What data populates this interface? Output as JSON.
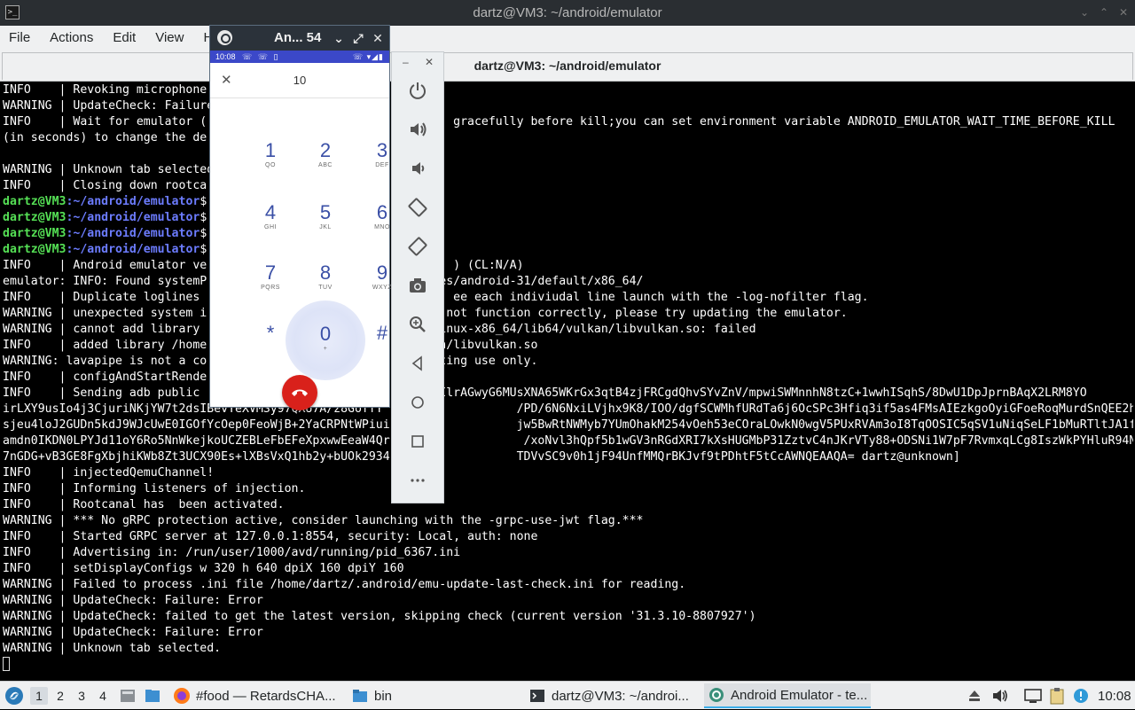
{
  "terminal": {
    "window_title": "dartz@VM3: ~/android/emulator",
    "menu": [
      "File",
      "Actions",
      "Edit",
      "View",
      "Help"
    ],
    "tab_title": "dartz@VM3: ~/android/emulator",
    "lines": [
      {
        "t": "INFO    | Revoking microphone"
      },
      {
        "t": "WARNING | UpdateCheck: Failure"
      },
      {
        "t": "INFO    | Wait for emulator (                                   gracefully before kill;you can set environment variable ANDROID_EMULATOR_WAIT_TIME_BEFORE_KILL"
      },
      {
        "t": "(in seconds) to change the de"
      },
      {
        "t": ""
      },
      {
        "t": "WARNING | Unknown tab selected"
      },
      {
        "t": "INFO    | Closing down rootca"
      },
      {
        "prompt": true,
        "user": "dartz@VM3",
        "path": ":~/android/emulator",
        "rest": "$"
      },
      {
        "prompt": true,
        "user": "dartz@VM3",
        "path": ":~/android/emulator",
        "rest": "$"
      },
      {
        "prompt": true,
        "user": "dartz@VM3",
        "path": ":~/android/emulator",
        "rest": "$"
      },
      {
        "prompt": true,
        "user": "dartz@VM3",
        "path": ":~/android/emulator",
        "rest": "$"
      },
      {
        "t": "INFO    | Android emulator ve                                   ) (CL:N/A)"
      },
      {
        "t": "emulator: INFO: Found systemP                               ages/android-31/default/x86_64/"
      },
      {
        "t": "INFO    | Duplicate loglines                                    ee each indiviudal line launch with the -log-nofilter flag."
      },
      {
        "t": "WARNING | unexpected system i                               nt not function correctly, please try updating the emulator."
      },
      {
        "t": "WARNING | cannot add library                                /linux-x86_64/lib64/vulkan/libvulkan.so: failed"
      },
      {
        "t": "INFO    | added library /home                               kan/libvulkan.so"
      },
      {
        "t": "WARNING: lavapipe is not a co                               esting use only."
      },
      {
        "t": "INFO    | configAndStartRende"
      },
      {
        "t": "INFO    | Sending adb public                                xUIlrAGwyG6MUsXNA65WKrGx3qtB4zjFRCgdQhvSYvZnV/mpwiSWMnnhN8tzC+1wwhISqhS/8DwU1DpJprnBAqX2LRM8YO"
      },
      {
        "t": "irLXY9usIo4j3CjuriNKjYW7t2dsIBevYeXVMSy97QXU7A/z8GoffY                   /PD/6N6NxiLVjhx9K8/IOO/dgfSCWMhfURdTa6j6OcSPc3Hfiq3if5as4FMsAIEzkgoOyiGFoeRoqMurdSnQEE2hfyY8al"
      },
      {
        "t": "sjeu4loJ2GUDn5kdJ9WJcUwE0IGOfYcOep0FeoWjB+2YaCRPNtWPiui                  jw5BwRtNWMyb7YUmOhakM254vOeh53eCOraLOwkN0wgV5PUxRVAm3oI8TqOOSIC5qSV1uNiqSeLF1bMuRTltJA1fKOkLvS"
      },
      {
        "t": "amdn0IKDN0LPYJd11oY6Ro5NnWkejkoUCZEBLeFbEFeXpxwwEeaW4Qr                   /xoNvl3hQpf5b1wGV3nRGdXRI7kXsHUGMbP31ZztvC4nJKrVTy88+ODSNi1W7pF7RvmxqLCg8IszWkPYHluR94Ngj8iRsK"
      },
      {
        "t": "7nGDG+vB3GE8FgXbjhiKWb8Zt3UCX90Es+lXBsVxQ1hb2y+bUOk2934                  TDVvSC9v0h1jF94UnfMMQrBKJvf9tPDhtF5tCcAWNQEAAQA= dartz@unknown]"
      },
      {
        "t": "INFO    | injectedQemuChannel!"
      },
      {
        "t": "INFO    | Informing listeners of injection."
      },
      {
        "t": "INFO    | Rootcanal has  been activated."
      },
      {
        "t": "WARNING | *** No gRPC protection active, consider launching with the -grpc-use-jwt flag.***"
      },
      {
        "t": "INFO    | Started GRPC server at 127.0.0.1:8554, security: Local, auth: none"
      },
      {
        "t": "INFO    | Advertising in: /run/user/1000/avd/running/pid_6367.ini"
      },
      {
        "t": "INFO    | setDisplayConfigs w 320 h 640 dpiX 160 dpiY 160"
      },
      {
        "t": "WARNING | Failed to process .ini file /home/dartz/.android/emu-update-last-check.ini for reading."
      },
      {
        "t": "WARNING | UpdateCheck: Failure: Error"
      },
      {
        "t": "WARNING | UpdateCheck: failed to get the latest version, skipping check (current version '31.3.10-8807927')"
      },
      {
        "t": "WARNING | UpdateCheck: Failure: Error"
      },
      {
        "t": "WARNING | Unknown tab selected."
      },
      {
        "cursor": true
      }
    ]
  },
  "emulator": {
    "title": "An... 54",
    "status_time": "10:08",
    "dial_number": "10",
    "keys": [
      {
        "d": "1",
        "l": "QO"
      },
      {
        "d": "2",
        "l": "ABC"
      },
      {
        "d": "3",
        "l": "DEF"
      },
      {
        "d": "4",
        "l": "GHI"
      },
      {
        "d": "5",
        "l": "JKL"
      },
      {
        "d": "6",
        "l": "MNO"
      },
      {
        "d": "7",
        "l": "PQRS"
      },
      {
        "d": "8",
        "l": "TUV"
      },
      {
        "d": "9",
        "l": "WXYZ"
      },
      {
        "d": "*",
        "l": ""
      },
      {
        "d": "0",
        "l": "+"
      },
      {
        "d": "#",
        "l": ""
      }
    ],
    "panel_buttons": [
      "power-icon",
      "volume-up-icon",
      "volume-down-icon",
      "rotate-left-icon",
      "rotate-right-icon",
      "camera-icon",
      "zoom-icon",
      "back-icon",
      "home-icon",
      "overview-icon",
      "more-icon"
    ]
  },
  "taskbar": {
    "desktops": [
      "1",
      "2",
      "3",
      "4"
    ],
    "tasks": [
      {
        "label": "#food — RetardsCHA..."
      },
      {
        "label": "bin"
      },
      {
        "label": "dartz@VM3: ~/androi..."
      },
      {
        "label": "Android Emulator - te..."
      }
    ],
    "clock": "10:08"
  }
}
